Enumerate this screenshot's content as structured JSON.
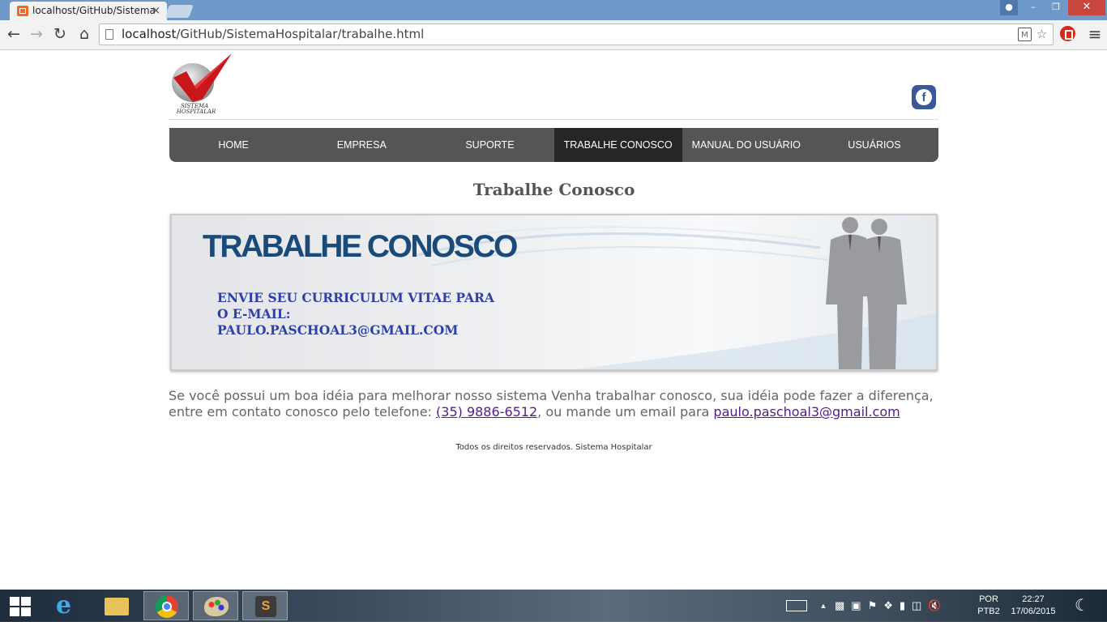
{
  "browser": {
    "tab_title": "localhost/GitHub/Sistema",
    "tab_close": "×",
    "url_host": "localhost",
    "url_path": "/GitHub/SistemaHospitalar/trabalhe.html",
    "window_controls": {
      "minimize": "–",
      "maximize": "❐",
      "close": "✕"
    }
  },
  "site": {
    "logo_text_1": "SISTEMA",
    "logo_text_2": "HOSPITALAR",
    "facebook_letter": "f",
    "nav": [
      "HOME",
      "EMPRESA",
      "SUPORTE",
      "TRABALHE CONOSCO",
      "MANUAL DO USUÁRIO",
      "USUÁRIOS"
    ],
    "active_nav": "TRABALHE CONOSCO",
    "page_title": "Trabalhe Conosco",
    "banner": {
      "title": "TRABALHE CONOSCO",
      "line1": "ENVIE SEU CURRICULUM VITAE PARA",
      "line2": "O E-MAIL:",
      "line3": "PAULO.PASCHOAL3@GMAIL.COM"
    },
    "body": {
      "text_before": "Se você possui um boa idéia para melhorar nosso sistema Venha trabalhar conosco, sua idéia pode fazer a diferença, entre em contato conosco pelo telefone: ",
      "phone": "(35) 9886-6512",
      "text_middle": ", ou mande um email para ",
      "email": "paulo.paschoal3@gmail.com"
    },
    "footer": "Todos os direitos reservados. Sistema Hospitalar"
  },
  "taskbar": {
    "language": "POR",
    "keyboard_layout": "PTB2",
    "time": "22:27",
    "date": "17/06/2015",
    "sublime_letter": "S",
    "ie_letter": "e"
  },
  "colors": {
    "nav_bg": "#555555",
    "nav_active": "#262626",
    "banner_title": "#1a4a7a",
    "banner_text": "#2f3fa8",
    "facebook": "#3b5998",
    "link": "#551a8b"
  }
}
